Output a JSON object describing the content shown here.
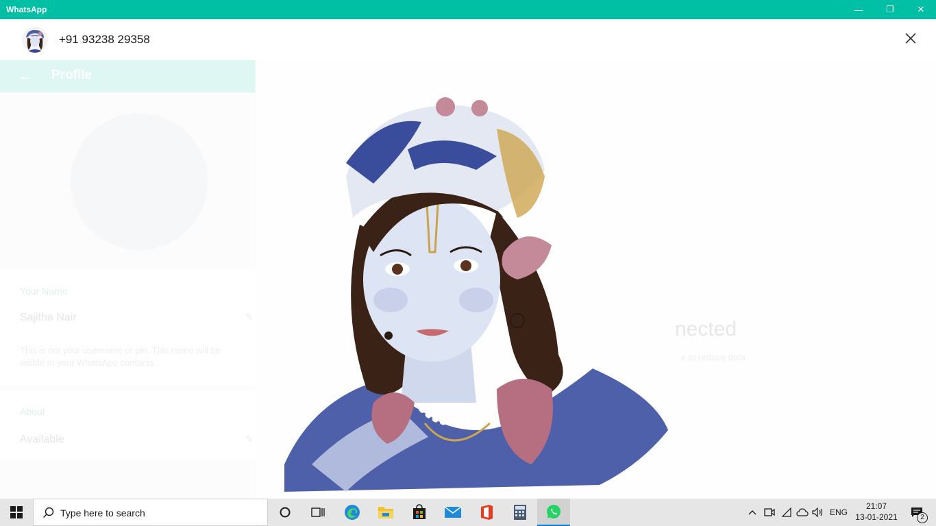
{
  "window": {
    "title": "WhatsApp",
    "minimize_label": "—",
    "restore_label": "❐",
    "close_label": "✕"
  },
  "background": {
    "profile_title": "Profile",
    "name_label": "Your Name",
    "name_value": "Sajitha Nair",
    "name_note": "This is not your username or pin. This name will be visible to your WhatsApp contacts.",
    "about_label": "About",
    "about_value": "Available",
    "right_heading": "nected",
    "right_sub1": "e to reduce data",
    "right_sub2": "."
  },
  "viewer": {
    "contact": "+91 93238 29358"
  },
  "taskbar": {
    "search_placeholder": "Type here to search",
    "language": "ENG",
    "time": "21:07",
    "date": "13-01-2021",
    "notifications": "2",
    "icons": [
      "windows-start-icon",
      "cortana-icon",
      "task-view-icon",
      "edge-icon",
      "file-explorer-icon",
      "store-icon",
      "mail-icon",
      "office-icon",
      "calculator-icon",
      "whatsapp-icon"
    ]
  },
  "colors": {
    "accent": "#00bfa5",
    "taskbar": "#e6e6e6",
    "whatsapp_green": "#25d366"
  }
}
